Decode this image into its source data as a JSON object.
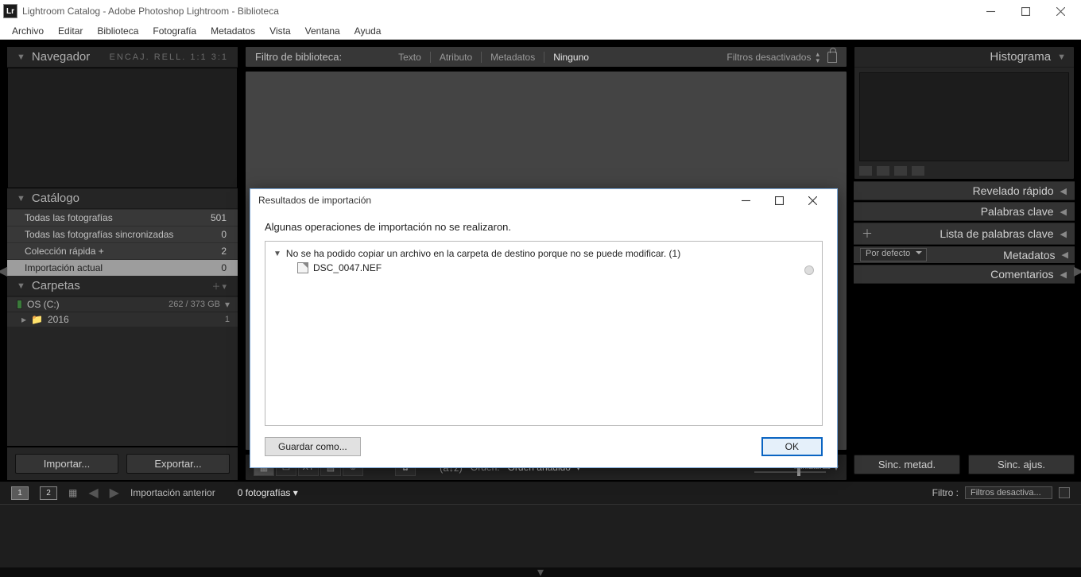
{
  "title": "Lightroom Catalog - Adobe Photoshop Lightroom - Biblioteca",
  "menu": [
    "Archivo",
    "Editar",
    "Biblioteca",
    "Fotografía",
    "Metadatos",
    "Vista",
    "Ventana",
    "Ayuda"
  ],
  "left": {
    "navigator": "Navegador",
    "navextras": "ENCAJ.   RELL.   1:1   3:1",
    "catalog": "Catálogo",
    "catalogItems": [
      {
        "label": "Todas las fotografías",
        "count": "501"
      },
      {
        "label": "Todas las fotografías sincronizadas",
        "count": "0"
      },
      {
        "label": "Colección rápida  +",
        "count": "2"
      },
      {
        "label": "Importación actual",
        "count": "0",
        "selected": true
      }
    ],
    "folders": "Carpetas",
    "disk": {
      "name": "OS (C:)",
      "size": "262 / 373 GB"
    },
    "folder": {
      "name": "2016",
      "count": "1"
    },
    "import": "Importar...",
    "export": "Exportar..."
  },
  "filterbar": {
    "label": "Filtro de biblioteca:",
    "items": [
      "Texto",
      "Atributo",
      "Metadatos",
      "Ninguno"
    ],
    "activeIndex": 3,
    "right": "Filtros desactivados"
  },
  "toolbar": {
    "order": "Orden:",
    "orderval": "Orden añadido",
    "thumb": "Miniaturas"
  },
  "right": {
    "histogram": "Histograma",
    "quickdev": "Revelado rápido",
    "keywords": "Palabras clave",
    "kwlist": "Lista de palabras clave",
    "metadata": "Metadatos",
    "metasel": "Por defecto",
    "comments": "Comentarios",
    "syncmeta": "Sinc. metad.",
    "syncadj": "Sinc. ajus."
  },
  "status": {
    "prev": "Importación anterior",
    "count": "0 fotografías",
    "filter": "Filtro :",
    "filtval": "Filtros desactiva..."
  },
  "dialog": {
    "title": "Resultados de importación",
    "message": "Algunas operaciones de importación no se realizaron.",
    "err": "No se ha podido copiar un archivo en la carpeta de destino porque no se puede modificar. (1)",
    "file": "DSC_0047.NEF",
    "save": "Guardar como...",
    "ok": "OK"
  }
}
